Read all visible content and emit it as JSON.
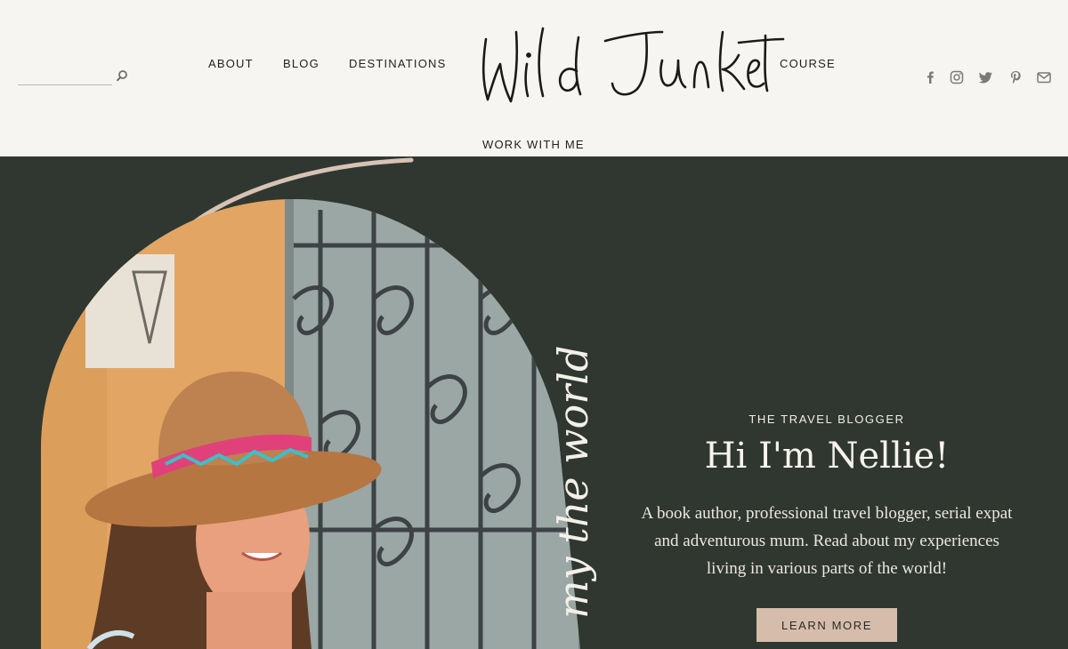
{
  "search": {
    "placeholder": "",
    "value": "",
    "icon": "search-icon"
  },
  "nav": {
    "about": "ABOUT",
    "blog": "BLOG",
    "destinations": "DESTINATIONS",
    "course": "COURSE",
    "work_with_me": "WORK WITH ME"
  },
  "logo": {
    "text": "Wild Junket"
  },
  "social": [
    "facebook-icon",
    "instagram-icon",
    "twitter-icon",
    "pinterest-icon",
    "mail-icon"
  ],
  "hero": {
    "eyebrow": "THE TRAVEL BLOGGER",
    "headline": "Hi I'm Nellie!",
    "intro": "A book author, professional travel blogger, serial expat and adventurous mum. Read about my experiences living in various parts of the world!",
    "cta": "LEARN MORE",
    "vertical_script": "my the world"
  },
  "colors": {
    "header_bg": "#f6f5f1",
    "hero_bg": "#2f3730",
    "accent": "#d6bdab",
    "text_dark": "#1f1f1f",
    "text_light": "#f1ede6"
  }
}
